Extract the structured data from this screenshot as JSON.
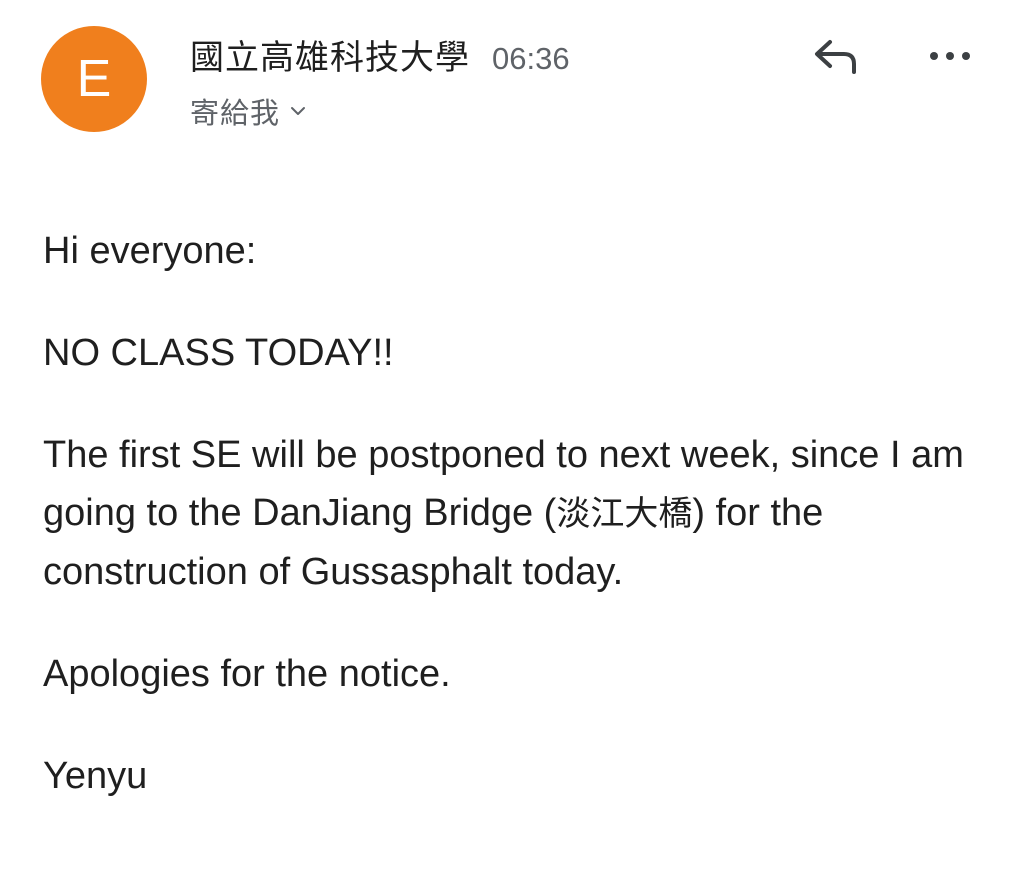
{
  "sender": {
    "avatar_letter": "E",
    "avatar_color": "#f07f1d",
    "name": "國立高雄科技大學",
    "time": "06:36"
  },
  "recipient": {
    "label": "寄給我",
    "chevron_icon": "chevron-down-icon"
  },
  "actions": {
    "reply_icon": "reply-icon",
    "more_icon": "more-horizontal-icon"
  },
  "message": {
    "greeting": "Hi everyone:",
    "headline": "NO CLASS TODAY!!",
    "paragraph_part1": "The first SE will be postponed to next week, since I am going to the DanJiang Bridge (",
    "paragraph_cjk": "淡江大橋",
    "paragraph_part2": ") for the construction of Gussasphalt today.",
    "apology": "Apologies for the notice.",
    "signature": "Yenyu"
  }
}
